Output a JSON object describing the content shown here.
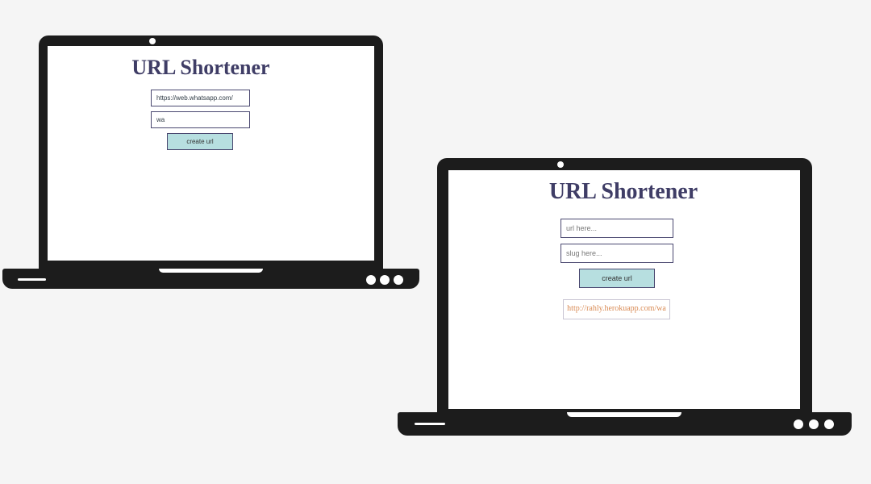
{
  "laptop_left": {
    "app": {
      "title": "URL Shortener",
      "url_input": {
        "value": "https://web.whatsapp.com/",
        "placeholder": "url here..."
      },
      "slug_input": {
        "value": "wa",
        "placeholder": "slug here..."
      },
      "create_button_label": "create url"
    }
  },
  "laptop_right": {
    "app": {
      "title": "URL Shortener",
      "url_input": {
        "value": "",
        "placeholder": "url here..."
      },
      "slug_input": {
        "value": "",
        "placeholder": "slug here..."
      },
      "create_button_label": "create url",
      "result_link": "http://rahly.herokuapp.com/wa"
    }
  },
  "colors": {
    "background": "#f5f5f5",
    "laptop_body": "#1c1c1c",
    "title": "#3f3d66",
    "button_fill": "#b7dfe0",
    "result_text": "#d98b55"
  }
}
